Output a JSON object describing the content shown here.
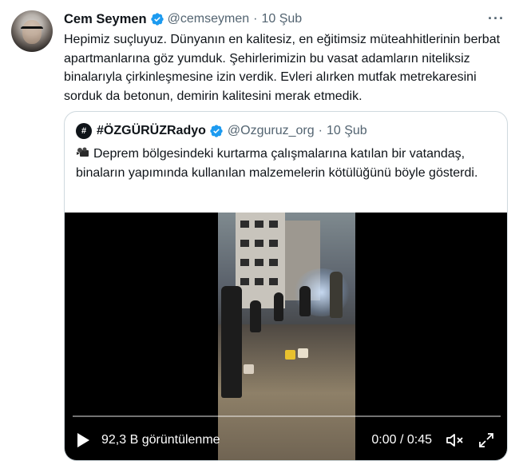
{
  "tweet": {
    "author_name": "Cem Seymen",
    "handle": "@cemseymen",
    "separator": "·",
    "date": "10 Şub",
    "more": "···",
    "text": "Hepimiz suçluyuz. Dünyanın en kalitesiz, en eğitimsiz müteahhitlerinin berbat apartmanlarına göz yumduk. Şehirlerimizin bu vasat adamların niteliksiz binalarıyla çirkinleşmesine izin verdik. Evleri alırken mutfak metrekaresini sorduk da betonun, demirin kalitesini merak etmedik."
  },
  "quote": {
    "avatar_glyph": "#",
    "author_name": "#ÖZGÜRÜZRadyo",
    "handle": "@Ozguruz_org",
    "separator": "·",
    "date": "10 Şub",
    "text": "Deprem bölgesindeki kurtarma çalışmalarına katılan bir vatandaş, binaların yapımında kullanılan malzemelerin kötülüğünü böyle gösterdi."
  },
  "video": {
    "views": "92,3 B görüntülenme",
    "time": "0:00 / 0:45",
    "progress": 0.0
  },
  "colors": {
    "verified_blue": "#1d9bf0",
    "secondary_text": "#536471",
    "border": "#cfd9de"
  },
  "icons": [
    "verified-badge-icon",
    "more-icon",
    "camera-icon",
    "play-icon",
    "mute-icon",
    "fullscreen-icon"
  ]
}
